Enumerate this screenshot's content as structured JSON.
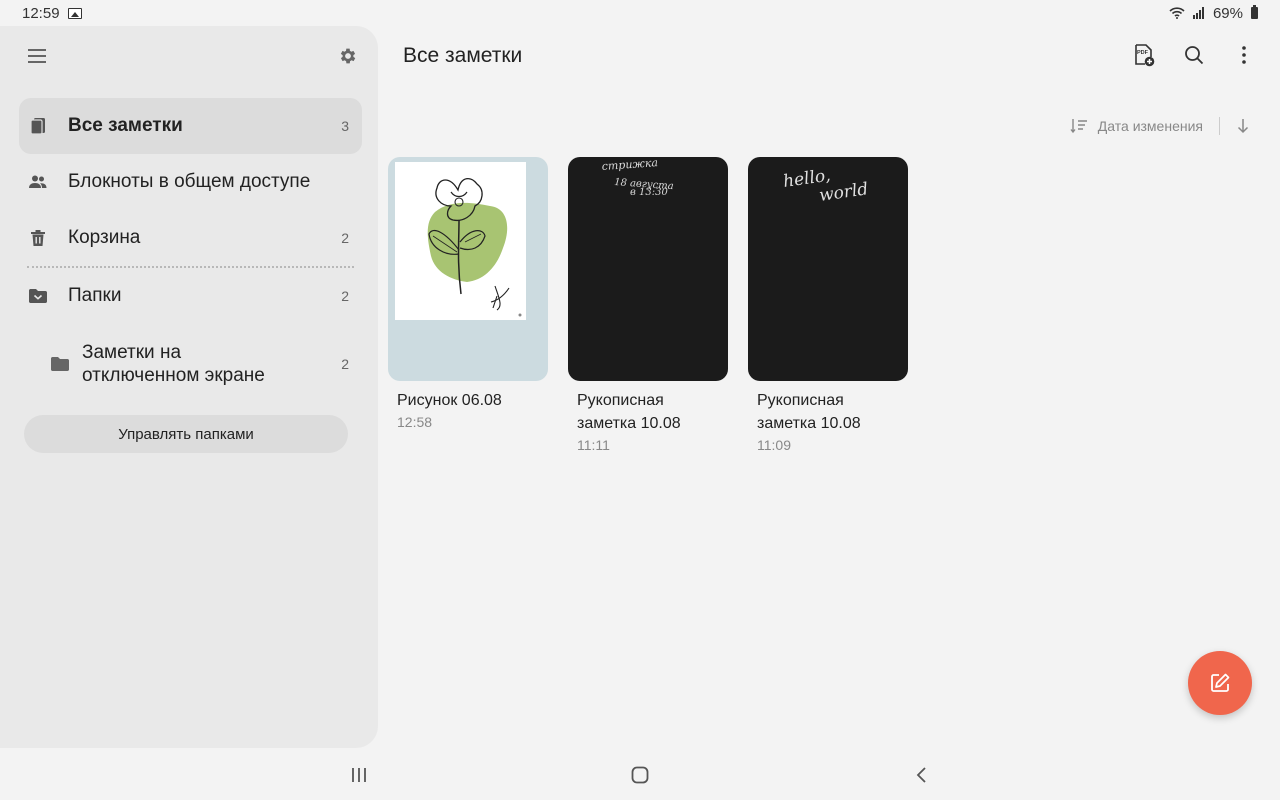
{
  "status_bar": {
    "time": "12:59",
    "battery": "69%"
  },
  "sidebar": {
    "items": [
      {
        "label": "Все заметки",
        "count": "3"
      },
      {
        "label": "Блокноты в общем доступе",
        "count": ""
      },
      {
        "label": "Корзина",
        "count": "2"
      },
      {
        "label": "Папки",
        "count": "2"
      }
    ],
    "subfolder": {
      "label_line1": "Заметки на",
      "label_line2": "отключенном экране",
      "count": "2"
    },
    "manage_label": "Управлять папками"
  },
  "header": {
    "title": "Все заметки"
  },
  "sort": {
    "label": "Дата изменения"
  },
  "notes": [
    {
      "title": "Рисунок 06.08",
      "title2": "",
      "time": "12:58"
    },
    {
      "title": "Рукописная",
      "title2": "заметка 10.08",
      "time": "11:11",
      "handwriting": [
        "стрижка",
        "18 августа",
        "в 13:30"
      ]
    },
    {
      "title": "Рукописная",
      "title2": "заметка 10.08",
      "time": "11:09",
      "handwriting": [
        "hello,",
        "world"
      ]
    }
  ],
  "colors": {
    "accent": "#f0664c",
    "sidebar_bg": "#e9e9e9",
    "page_bg": "#f3f3f3",
    "thumb_light": "#ccdbe0",
    "thumb_dark": "#1b1b1b"
  }
}
